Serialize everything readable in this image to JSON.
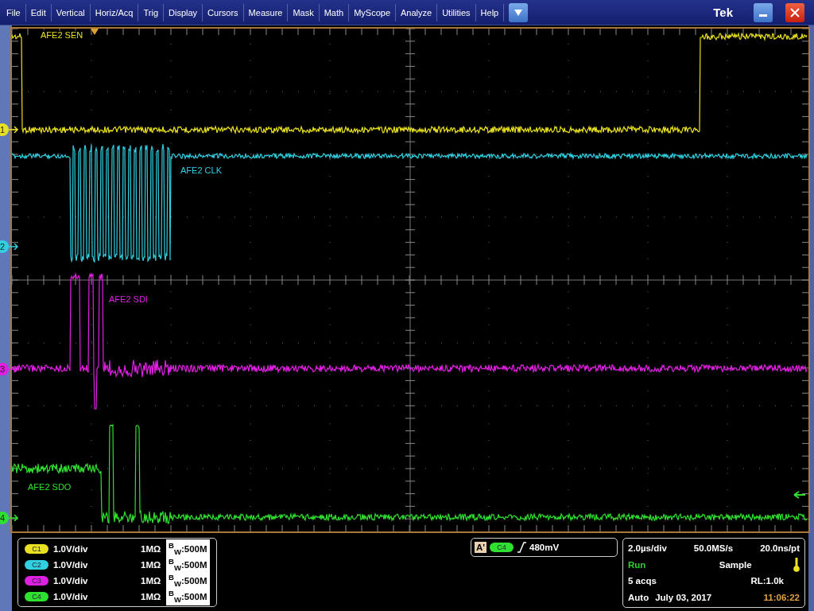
{
  "menu": [
    "File",
    "Edit",
    "Vertical",
    "Horiz/Acq",
    "Trig",
    "Display",
    "Cursors",
    "Measure",
    "Mask",
    "Math",
    "MyScope",
    "Analyze",
    "Utilities",
    "Help"
  ],
  "title": "Tek",
  "channels": [
    {
      "number": "1",
      "label": "AFE2 SEN",
      "badge": "C1",
      "color": "#e8e020",
      "scale": "1.0V/div",
      "impedance": "1MΩ",
      "bandwidth": "$^{B}$$_{W}$:500M"
    },
    {
      "number": "2",
      "label": "AFE2 CLK",
      "badge": "C2",
      "color": "#30d0e0",
      "scale": "1.0V/div",
      "impedance": "1MΩ",
      "bandwidth": "$^{B}$$_{W}$:500M"
    },
    {
      "number": "3",
      "label": "AFE2 SDI",
      "badge": "C3",
      "color": "#e020e0",
      "scale": "1.0V/div",
      "impedance": "1MΩ",
      "bandwidth": "$^{B}$$_{W}$:500M"
    },
    {
      "number": "4",
      "label": "AFE2 SDO",
      "badge": "C4",
      "color": "#30e030",
      "scale": "1.0V/div",
      "impedance": "1MΩ",
      "bandwidth": "$^{B}$$_{W}$:500M"
    }
  ],
  "trigger": {
    "label": "A'",
    "source": "C4",
    "color": "#30e030",
    "level": "480mV"
  },
  "acquisition": {
    "time_div": "2.0µs/div",
    "sample_rate": "50.0MS/s",
    "resolution": "20.0ns/pt",
    "state": "Run",
    "mode": "Sample",
    "count": "5 acqs",
    "record_length": "RL:1.0k",
    "trigger_mode": "Auto",
    "date": "July 03, 2017",
    "time": "11:06:22"
  }
}
